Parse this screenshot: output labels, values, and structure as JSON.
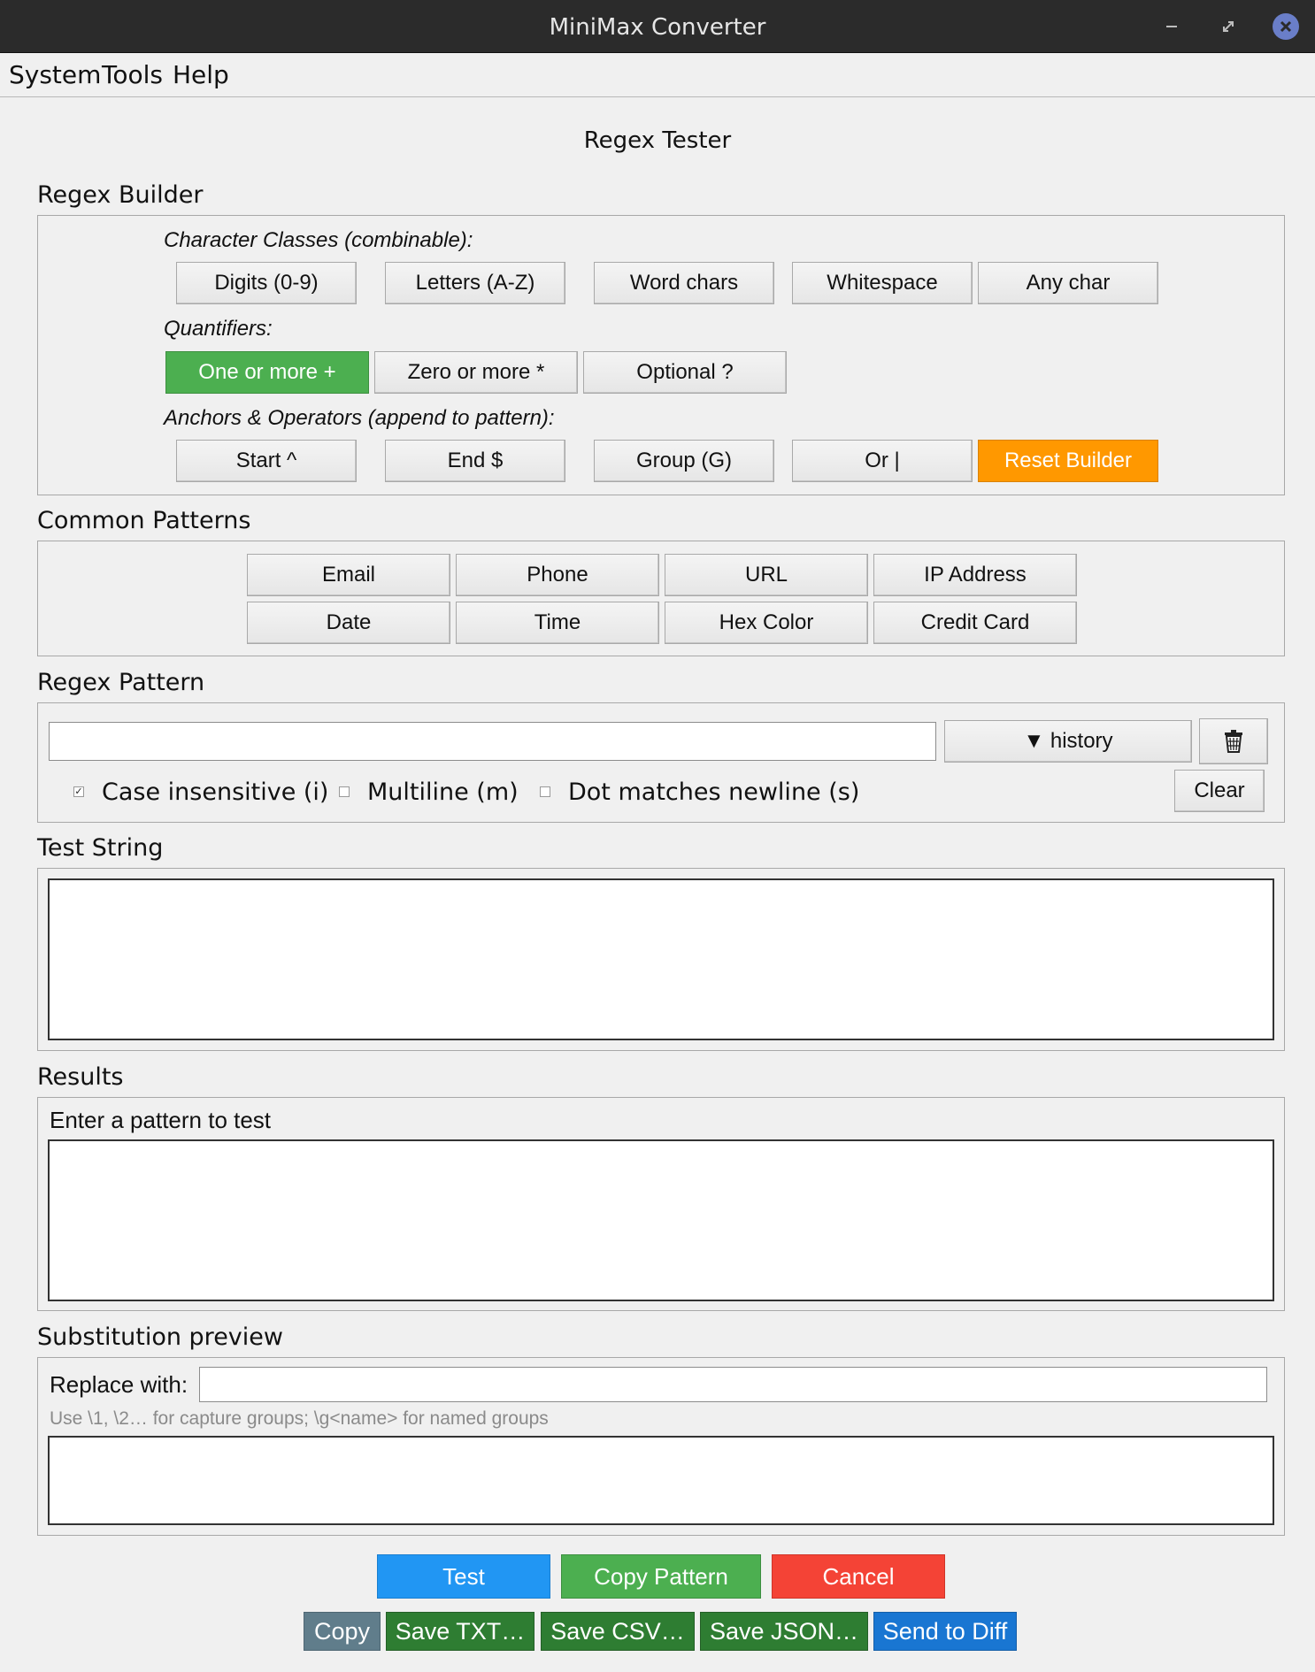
{
  "window": {
    "title": "MiniMax Converter"
  },
  "menubar": {
    "items": [
      "System",
      "Tools",
      "Help"
    ]
  },
  "page": {
    "title": "Regex Tester"
  },
  "builder": {
    "section_label": "Regex Builder",
    "char_classes_label": "Character Classes (combinable):",
    "char_classes": [
      "Digits (0-9)",
      "Letters (A-Z)",
      "Word chars",
      "Whitespace",
      "Any char"
    ],
    "quantifiers_label": "Quantifiers:",
    "quantifiers": [
      "One or more +",
      "Zero or more *",
      "Optional ?"
    ],
    "anchors_label": "Anchors & Operators (append to pattern):",
    "anchors": [
      "Start ^",
      "End $",
      "Group (G)",
      "Or |"
    ],
    "reset_label": "Reset Builder"
  },
  "common": {
    "section_label": "Common Patterns",
    "patterns": [
      "Email",
      "Phone",
      "URL",
      "IP Address",
      "Date",
      "Time",
      "Hex Color",
      "Credit Card"
    ]
  },
  "pattern": {
    "section_label": "Regex Pattern",
    "value": "",
    "history_label": "▼ history",
    "clear_label": "Clear",
    "flags": [
      {
        "label": "Case insensitive (i)",
        "checked": true
      },
      {
        "label": "Multiline (m)",
        "checked": false
      },
      {
        "label": "Dot matches newline (s)",
        "checked": false
      }
    ]
  },
  "test_string": {
    "section_label": "Test String",
    "value": ""
  },
  "results": {
    "section_label": "Results",
    "status": "Enter a pattern to test",
    "value": ""
  },
  "substitution": {
    "section_label": "Substitution preview",
    "replace_label": "Replace with:",
    "replace_value": "",
    "hint": "Use \\1, \\2… for capture groups; \\g<name> for named groups",
    "preview": ""
  },
  "actions": {
    "test": "Test",
    "copy_pattern": "Copy Pattern",
    "cancel": "Cancel"
  },
  "export": {
    "copy": "Copy",
    "save_txt": "Save TXT…",
    "save_csv": "Save CSV…",
    "save_json": "Save JSON…",
    "send_diff": "Send to Diff"
  },
  "colors": {
    "green": "#4caf50",
    "orange": "#ff9800",
    "blue": "#2196f3",
    "red": "#f44336",
    "dark_green": "#2e7d32",
    "slate": "#607d8b",
    "dark_blue": "#1976d2"
  }
}
